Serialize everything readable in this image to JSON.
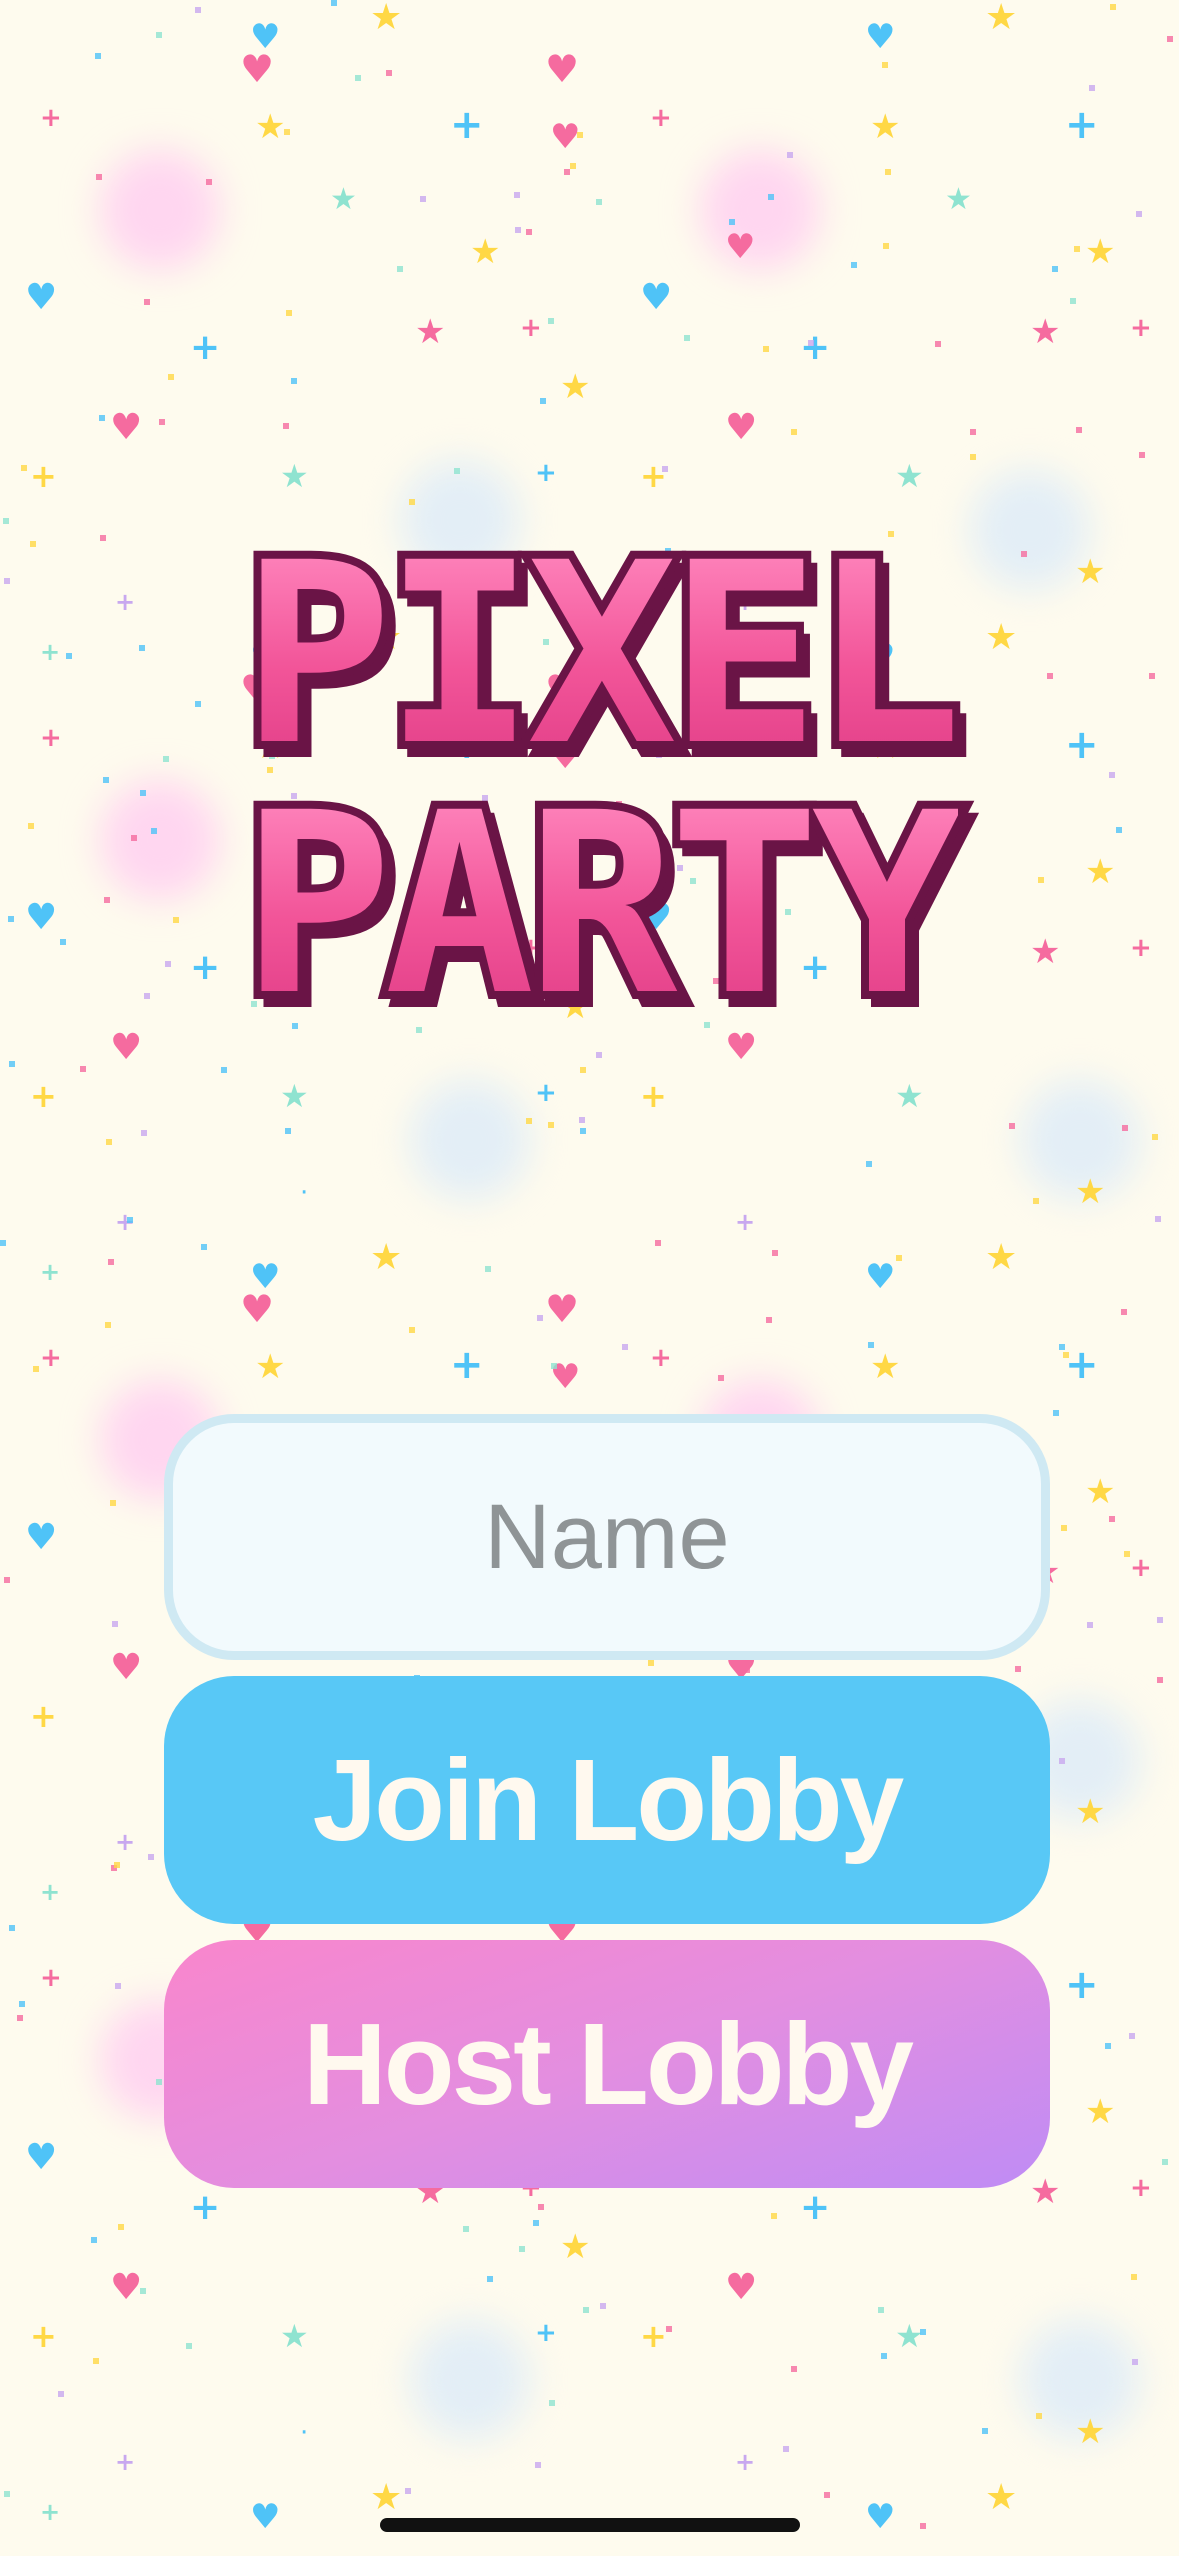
{
  "title": {
    "line1": "PIXEL",
    "line2": "PARTY"
  },
  "form": {
    "name_placeholder": "Name",
    "name_value": "",
    "join_label": "Join Lobby",
    "host_label": "Host Lobby"
  },
  "colors": {
    "background": "#fefbee",
    "title_fill": "#f25599",
    "title_outline": "#6a1446",
    "input_bg": "#f2fafd",
    "input_border": "#cfe9f3",
    "join_button": "#58c8f6",
    "host_button_start": "#f986cc",
    "host_button_end": "#bf8cf5",
    "button_text": "#fff9ef",
    "confetti": [
      "#f56b9f",
      "#ffd845",
      "#4fc3f7",
      "#8fe3d0",
      "#c8a8ef"
    ]
  },
  "icons": [
    "heart-icon",
    "star-icon",
    "plus-icon",
    "pixel-dot"
  ]
}
